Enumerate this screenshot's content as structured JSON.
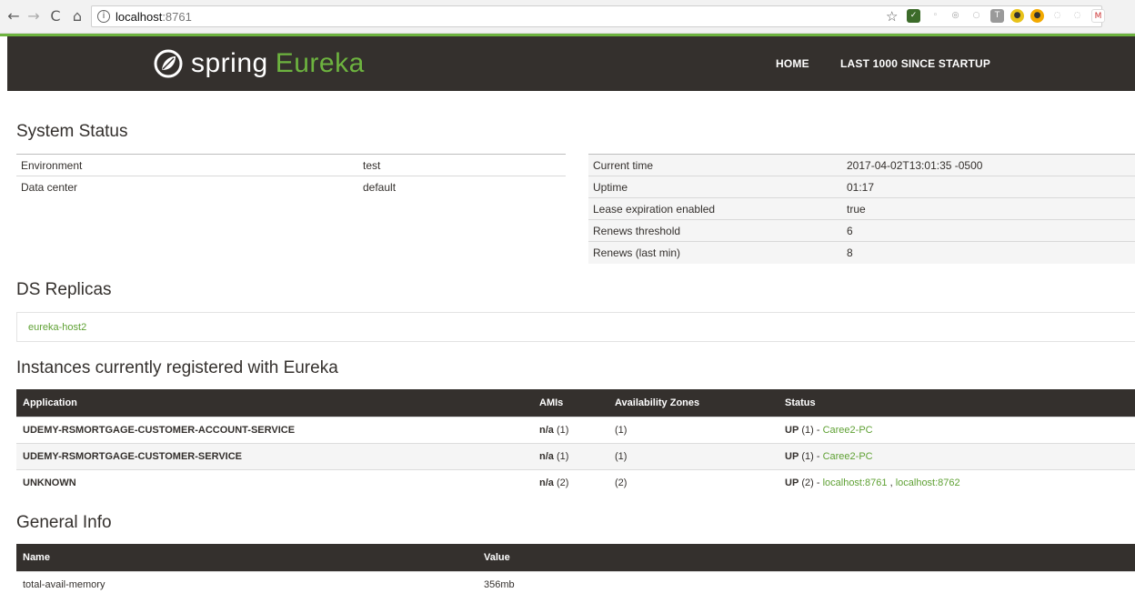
{
  "browser": {
    "back_icon": "back-arrow-icon",
    "address_host": "localhost",
    "address_port": ":8761",
    "bookmark_icon": "star-icon"
  },
  "header": {
    "brand_spring": "spring",
    "brand_eureka": "Eureka",
    "nav": [
      "HOME",
      "LAST 1000 SINCE STARTUP"
    ]
  },
  "system_status": {
    "title": "System Status",
    "left": [
      {
        "key": "Environment",
        "value": "test"
      },
      {
        "key": "Data center",
        "value": "default"
      }
    ],
    "right": [
      {
        "key": "Current time",
        "value": "2017-04-02T13:01:35 -0500"
      },
      {
        "key": "Uptime",
        "value": "01:17"
      },
      {
        "key": "Lease expiration enabled",
        "value": "true"
      },
      {
        "key": "Renews threshold",
        "value": "6"
      },
      {
        "key": "Renews (last min)",
        "value": "8"
      }
    ]
  },
  "ds_replicas": {
    "title": "DS Replicas",
    "items": [
      "eureka-host2"
    ]
  },
  "instances": {
    "title": "Instances currently registered with Eureka",
    "columns": [
      "Application",
      "AMIs",
      "Availability Zones",
      "Status"
    ],
    "rows": [
      {
        "application": "UDEMY-RSMORTGAGE-CUSTOMER-ACCOUNT-SERVICE",
        "amis_label": "n/a",
        "amis_count": "(1)",
        "zones": "(1)",
        "status_label": "UP",
        "status_count": "(1) -",
        "links": [
          "Caree2-PC"
        ]
      },
      {
        "application": "UDEMY-RSMORTGAGE-CUSTOMER-SERVICE",
        "amis_label": "n/a",
        "amis_count": "(1)",
        "zones": "(1)",
        "status_label": "UP",
        "status_count": "(1) -",
        "links": [
          "Caree2-PC"
        ]
      },
      {
        "application": "UNKNOWN",
        "amis_label": "n/a",
        "amis_count": "(2)",
        "zones": "(2)",
        "status_label": "UP",
        "status_count": "(2) -",
        "links": [
          "localhost:8761",
          "localhost:8762"
        ]
      }
    ]
  },
  "general_info": {
    "title": "General Info",
    "columns": [
      "Name",
      "Value"
    ],
    "rows": [
      {
        "name": "total-avail-memory",
        "value": "356mb"
      }
    ]
  },
  "colors": {
    "accent_green": "#6db33f",
    "header_dark": "#34302d",
    "link_green": "#5fa134"
  }
}
